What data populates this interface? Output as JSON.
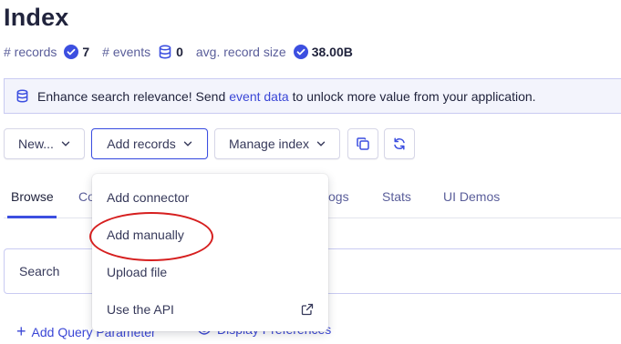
{
  "page": {
    "title": "Index"
  },
  "stats": {
    "records_label": "# records",
    "records_value": "7",
    "events_label": "# events",
    "events_value": "0",
    "size_label": "avg. record size",
    "size_value": "38.00B"
  },
  "banner": {
    "text_before": "Enhance search relevance! Send",
    "link": "event data",
    "text_after": "to unlock more value from your application."
  },
  "toolbar": {
    "new_label": "New...",
    "add_records_label": "Add records",
    "manage_index_label": "Manage index"
  },
  "tabs": [
    {
      "label": "Browse",
      "active": true
    },
    {
      "label": "Co"
    },
    {
      "label": "ogs"
    },
    {
      "label": "Stats"
    },
    {
      "label": "UI Demos"
    }
  ],
  "search": {
    "label": "Search"
  },
  "bottom": {
    "add_query_label": "Add Query Parameter",
    "display_prefs_label": "Display Preferences"
  },
  "dropdown": {
    "items": [
      {
        "label": "Add connector"
      },
      {
        "label": "Add manually"
      },
      {
        "label": "Upload file"
      },
      {
        "label": "Use the API",
        "icon": "external-link-icon"
      }
    ]
  },
  "colors": {
    "accent": "#3c4fe0",
    "link": "#3a46d6",
    "annotation": "#d61f1f"
  }
}
